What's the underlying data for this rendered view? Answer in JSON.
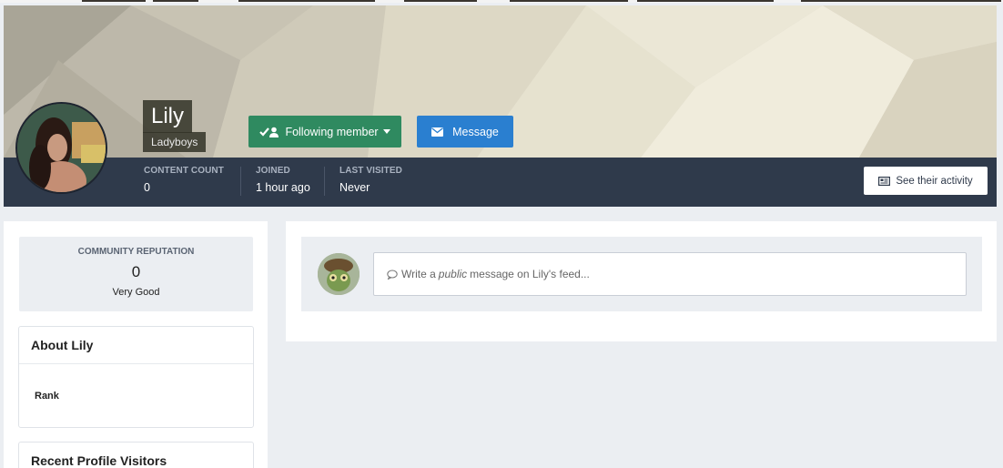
{
  "profile": {
    "name": "Lily",
    "group": "Ladyboys",
    "follow_label": "Following member",
    "message_label": "Message",
    "activity_label": "See their activity"
  },
  "stats": [
    {
      "label": "CONTENT COUNT",
      "value": "0"
    },
    {
      "label": "JOINED",
      "value": "1 hour ago"
    },
    {
      "label": "LAST VISITED",
      "value": "Never"
    }
  ],
  "reputation": {
    "label": "COMMUNITY REPUTATION",
    "value": "0",
    "text": "Very Good"
  },
  "about": {
    "title": "About Lily",
    "rank_label": "Rank"
  },
  "visitors": {
    "title": "Recent Profile Visitors"
  },
  "feed": {
    "prefix": "Write a",
    "emphasis": "public",
    "suffix": "message on Lily's feed..."
  },
  "icons": {
    "follow": "check-user-icon",
    "caret": "caret-down-icon",
    "message": "envelope-icon",
    "activity": "newspaper-icon",
    "comment": "comment-icon"
  },
  "colors": {
    "follow_button": "#2f8a60",
    "message_button": "#2a7fd0",
    "info_bar": "#2f3a4b"
  }
}
